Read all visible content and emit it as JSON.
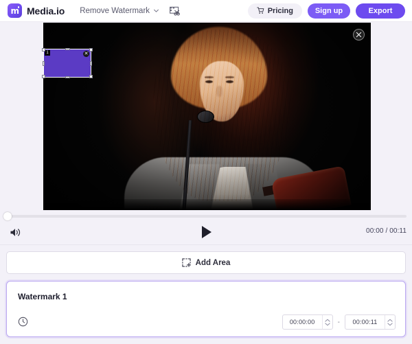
{
  "header": {
    "brand_name": "Media.io",
    "logo_letter": "m",
    "logo_icon": "mediaio-logo-icon",
    "tool_label": "Remove Watermark",
    "tool_chevron_icon": "chevron-down-icon",
    "cut_icon": "video-cut-icon",
    "pricing_label": "Pricing",
    "pricing_icon": "cart-icon",
    "signup_label": "Sign up",
    "export_label": "Export",
    "colors": {
      "brand_purple": "#6d4bef",
      "signup_purple": "#7c5cf5",
      "pricing_bg": "#f2f0f7",
      "page_bg": "#f3f1f8"
    }
  },
  "player": {
    "close_icon": "close-icon",
    "selection": {
      "index_label": "1",
      "close_icon": "selection-close-icon",
      "fill_color": "#5b3bc4"
    },
    "volume_icon": "volume-icon",
    "play_icon": "play-icon",
    "current_time": "00:00",
    "total_time": "00:11",
    "time_display": "00:00 / 00:11",
    "progress_percent": 0
  },
  "toolbar": {
    "add_area_label": "Add Area",
    "add_area_icon": "add-area-icon"
  },
  "watermark_panel": {
    "title": "Watermark 1",
    "clock_icon": "clock-icon",
    "start_time": "00:00:00",
    "end_time": "00:00:11",
    "separator": "-",
    "spinner_up_icon": "chevron-up-icon",
    "spinner_down_icon": "chevron-down-icon",
    "accent_border": "#b9a7f0"
  }
}
